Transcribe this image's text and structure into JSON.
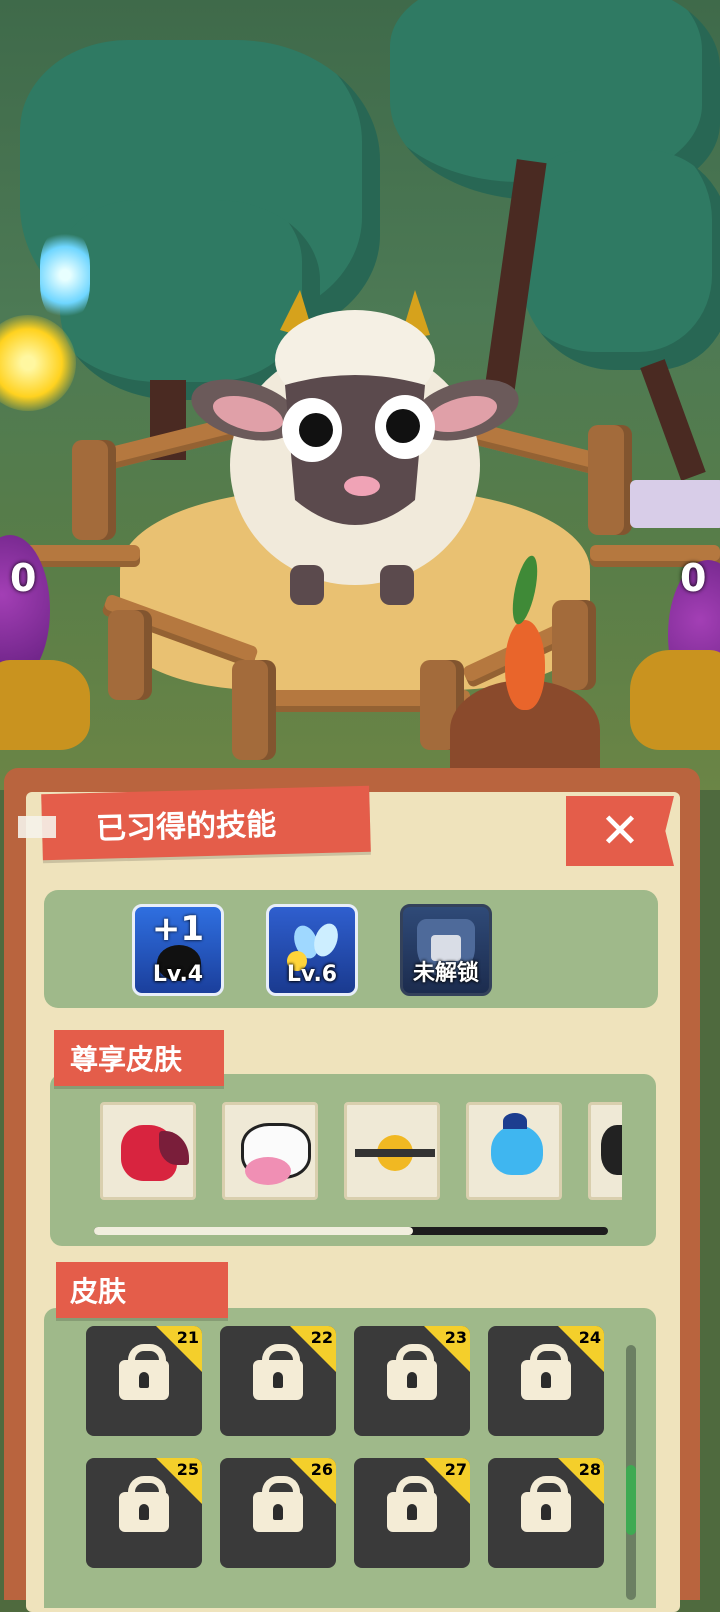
{
  "scene": {
    "left_egg_count": "0",
    "right_egg_count": "0"
  },
  "panel": {
    "title": "已习得的技能",
    "close_label": "✕",
    "skills": [
      {
        "top": "+1",
        "label": "Lv.4",
        "icon": "black-bomb-plus-icon"
      },
      {
        "top": "",
        "label": "Lv.6",
        "icon": "bee-wings-icon"
      },
      {
        "top": "",
        "label": "未解锁",
        "icon": "lock-shield-icon"
      }
    ],
    "premium_title": "尊享皮肤",
    "premium_skins": [
      {
        "icon": "red-dragon-skin"
      },
      {
        "icon": "cow-skin"
      },
      {
        "icon": "yellow-drone-skin"
      },
      {
        "icon": "blue-jellyfish-skin"
      },
      {
        "icon": "black-cat-skin"
      }
    ],
    "skins_title": "皮肤",
    "skins": [
      {
        "number": "21"
      },
      {
        "number": "22"
      },
      {
        "number": "23"
      },
      {
        "number": "24"
      },
      {
        "number": "25"
      },
      {
        "number": "26"
      },
      {
        "number": "27"
      },
      {
        "number": "28"
      }
    ],
    "premium_scroll_fraction": 0.62
  },
  "colors": {
    "ribbon": "#e45d4a",
    "panel_frame": "#b9643e",
    "panel_paper": "#efe3bc",
    "section_green": "#9fb98a",
    "badge_yellow": "#f4cf2b"
  }
}
